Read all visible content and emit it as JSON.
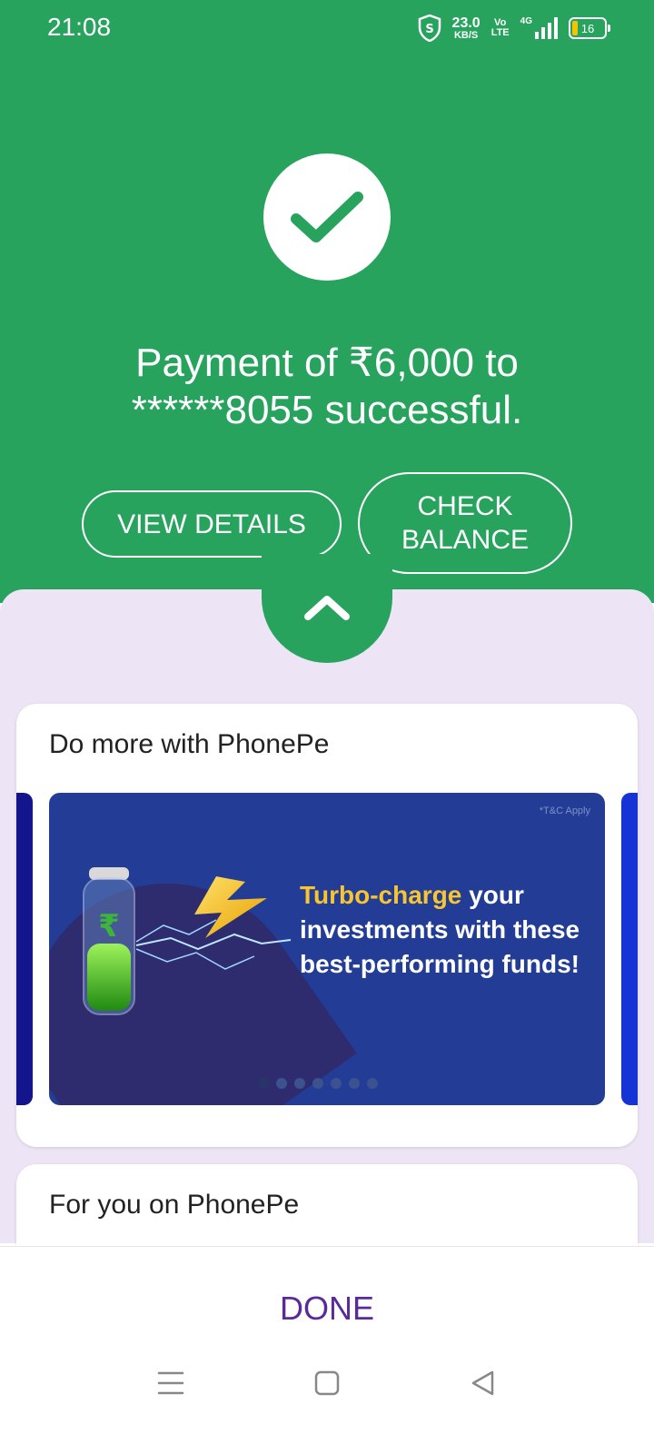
{
  "status_bar": {
    "time": "21:08",
    "net_speed_value": "23.0",
    "net_speed_unit": "KB/S",
    "volte_top": "Vo",
    "volte_bottom": "LTE",
    "network": "4G",
    "battery": "16"
  },
  "success": {
    "icon": "checkmark-icon",
    "title_line1": "Payment of ₹6,000 to",
    "title_line2": "******8055 successful.",
    "view_details_label": "VIEW DETAILS",
    "check_balance_line1": "CHECK",
    "check_balance_line2": "BALANCE"
  },
  "do_more": {
    "title": "Do more with PhonePe",
    "banner": {
      "tnc": "*T&C Apply",
      "highlight": "Turbo-charge",
      "text": " your investments with these best-performing funds!",
      "slide_count": 7,
      "active_slide": 0
    }
  },
  "for_you": {
    "title": "For you on PhonePe"
  },
  "done_label": "DONE",
  "colors": {
    "green": "#27a35e",
    "lavender": "#ede4f6",
    "banner_blue": "#233d96",
    "accent_purple": "#5a2a9a",
    "highlight_yellow": "#f7c530"
  }
}
